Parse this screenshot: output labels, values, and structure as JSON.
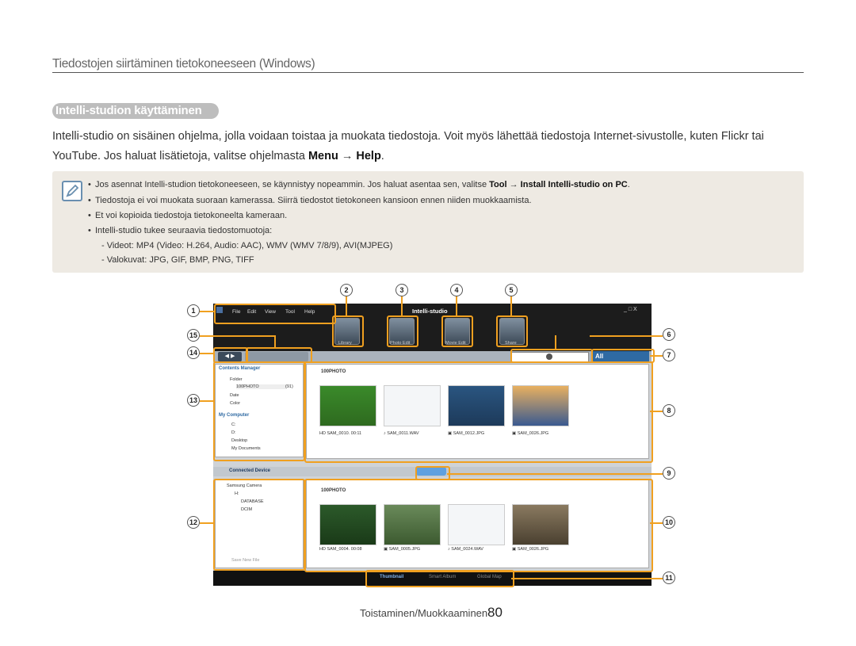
{
  "section_title": "Tiedostojen siirtäminen tietokoneeseen (Windows)",
  "subhead": "Intelli-studion käyttäminen",
  "intro_line1": "Intelli-studio on sisäinen ohjelma, jolla voidaan toistaa ja muokata tiedostoja. Voit myös lähettää tiedostoja Internet-sivustolle, kuten Flickr tai",
  "intro_line2_pre": "YouTube. Jos haluat lisätietoja, valitse ohjelmasta ",
  "intro_menu": "Menu",
  "intro_arrow": "→",
  "intro_help": "Help",
  "intro_end": ".",
  "note_icon": "pencil-note-icon",
  "notes": [
    {
      "pre": "Jos asennat Intelli-studion tietokoneeseen, se käynnistyy nopeammin. Jos haluat asentaa sen, valitse ",
      "b1": "Tool",
      "arrow": "→",
      "b2": "Install Intelli-studio on PC",
      "end": "."
    },
    {
      "text": "Tiedostoja ei voi muokata suoraan kamerassa. Siirrä tiedostot tietokoneen kansioon ennen niiden muokkaamista."
    },
    {
      "text": "Et voi kopioida tiedostoja tietokoneelta kameraan."
    },
    {
      "text": "Intelli-studio tukee seuraavia tiedostomuotoja:"
    }
  ],
  "sub_notes": [
    "- Videot: MP4 (Video: H.264, Audio: AAC), WMV (WMV 7/8/9), AVI(MJPEG)",
    "- Valokuvat: JPG, GIF, BMP, PNG, TIFF"
  ],
  "app": {
    "menu": [
      "File",
      "Edit",
      "View",
      "Tool",
      "Help"
    ],
    "logo": "Intelli-studio",
    "tools": [
      "Library",
      "Photo Edit",
      "Movie Edit",
      "Share"
    ],
    "filter_all": "All",
    "contents_manager": "Contents Manager",
    "tree1": [
      "Folder",
      "100PHOTO",
      "Date",
      "Color"
    ],
    "tree1_count": "(91)",
    "my_computer": "My Computer",
    "tree2": [
      "C:",
      "D:",
      "Desktop",
      "My Documents"
    ],
    "folder1": "100PHOTO",
    "files1": [
      {
        "badge": "HD",
        "name": "SAM_0010.",
        "dur": "00:11"
      },
      {
        "badge": "♪",
        "name": "SAM_0011.WAV",
        "dur": ""
      },
      {
        "badge": "▣",
        "name": "SAM_0012.JPG",
        "dur": ""
      },
      {
        "badge": "▣",
        "name": "SAM_0026.JPG",
        "dur": ""
      }
    ],
    "connected_device": "Connected Device",
    "tree3": [
      "Samsung Camera",
      "H:",
      "DATABASE",
      "DCIM"
    ],
    "save_new_file": "Save New File",
    "folder2": "100PHOTO",
    "files2": [
      {
        "badge": "HD",
        "name": "SAM_0004.",
        "dur": "00:08"
      },
      {
        "badge": "▣",
        "name": "SAM_0005.JPG",
        "dur": ""
      },
      {
        "badge": "♪",
        "name": "SAM_0024.WAV",
        "dur": ""
      },
      {
        "badge": "▣",
        "name": "SAM_0026.JPG",
        "dur": ""
      }
    ],
    "views": [
      "Thumbnail",
      "Smart Album",
      "Global Map"
    ],
    "window_controls": "_ □ X"
  },
  "callouts": [
    "1",
    "2",
    "3",
    "4",
    "5",
    "6",
    "7",
    "8",
    "9",
    "10",
    "11",
    "12",
    "13",
    "14",
    "15"
  ],
  "footer": "Toistaminen/Muokkaaminen",
  "page_number": "80",
  "colors": {
    "callout": "#f0a020",
    "note_bg": "#eeeae3"
  }
}
